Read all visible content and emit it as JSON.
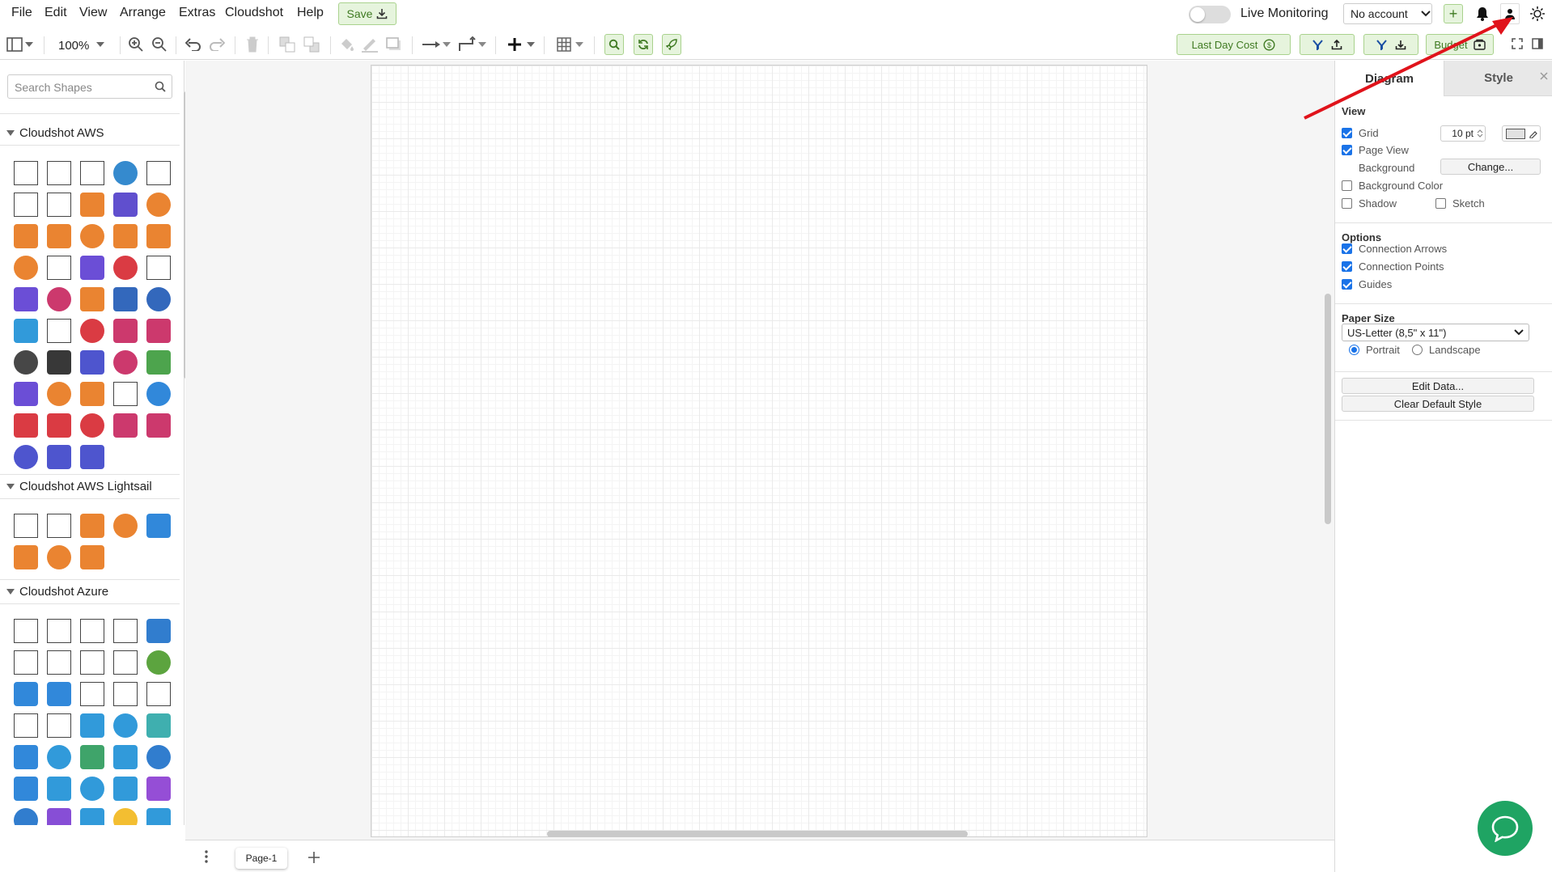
{
  "menubar": {
    "items": [
      "File",
      "Edit",
      "View",
      "Arrange",
      "Extras",
      "Cloudshot",
      "Help"
    ],
    "save_label": "Save",
    "live_monitoring_label": "Live Monitoring",
    "account_select": "No account"
  },
  "toolbar": {
    "zoom": "100%",
    "last_day_cost_label": "Last Day Cost",
    "budget_label": "Budget"
  },
  "sidebar": {
    "search_placeholder": "Search Shapes",
    "sections": [
      "Cloudshot AWS",
      "Cloudshot AWS Lightsail",
      "Cloudshot Azure"
    ]
  },
  "canvas": {
    "page_tab": "Page-1"
  },
  "panel": {
    "tabs": [
      "Diagram",
      "Style"
    ],
    "view_title": "View",
    "grid_label": "Grid",
    "grid_value": "10 pt",
    "page_view_label": "Page View",
    "background_label": "Background",
    "change_button": "Change...",
    "background_color_label": "Background Color",
    "shadow_label": "Shadow",
    "sketch_label": "Sketch",
    "options_title": "Options",
    "connection_arrows_label": "Connection Arrows",
    "connection_points_label": "Connection Points",
    "guides_label": "Guides",
    "paper_size_title": "Paper Size",
    "paper_size_value": "US-Letter (8,5\" x 11\")",
    "portrait_label": "Portrait",
    "landscape_label": "Landscape",
    "edit_data_button": "Edit Data...",
    "clear_style_button": "Clear Default Style"
  },
  "colors": {
    "accent_green": "#3f7a22",
    "annotation_arrow": "#e0131b",
    "chat_green": "#1fa463"
  }
}
